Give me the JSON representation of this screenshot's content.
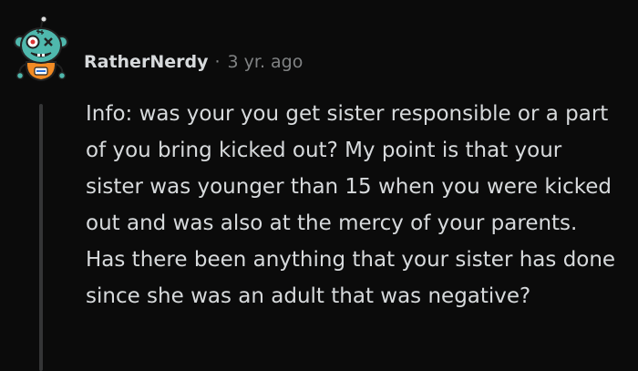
{
  "comment": {
    "author": "RatherNerdy",
    "separator": "·",
    "timestamp": "3 yr. ago",
    "body": "Info: was your you get sister responsible or a part of you bring kicked out? My point is that your sister was younger than 15 when you were kicked out and was also at the mercy of your parents. Has there been anything that your sister has done since she was an adult that was negative?",
    "avatar_icon": "zombie-snoo-avatar-icon"
  },
  "colors": {
    "background": "#0b0b0b",
    "text": "#d7dadc",
    "meta": "#818384",
    "thread_line": "#343536",
    "avatar_skin": "#4fb8ad"
  }
}
